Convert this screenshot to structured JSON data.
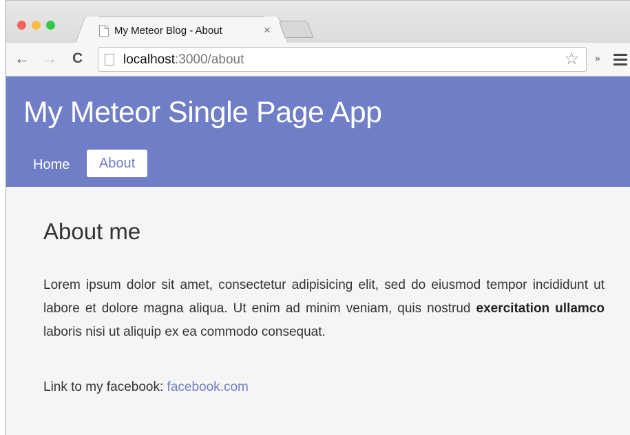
{
  "browser": {
    "traffic_lights": [
      "#fc605b",
      "#fdbc40",
      "#34c84a"
    ],
    "tab_title": "My Meteor Blog - About",
    "tab_close": "×",
    "back": "←",
    "forward": "→",
    "reload": "C",
    "url_host": "localhost",
    "url_path": ":3000/about",
    "star": "☆",
    "extensions": "»"
  },
  "page": {
    "site_title": "My Meteor Single Page App",
    "nav": {
      "home": "Home",
      "about": "About"
    },
    "heading": "About me",
    "paragraph": {
      "part1": "Lorem ipsum dolor sit amet, consectetur adipisicing elit, sed do eiusmod tempor incididunt ut labore et dolore magna aliqua. Ut enim ad minim veniam, quis nostrud ",
      "bold": "exercitation ullamco",
      "part2": " laboris nisi ut aliquip ex ea commodo consequat."
    },
    "facebook_label": "Link to my facebook: ",
    "facebook_link": "facebook.com"
  },
  "colors": {
    "header_bg": "#6f7ec7",
    "page_bg": "#f5f5f5",
    "link": "#6f7ec7"
  }
}
